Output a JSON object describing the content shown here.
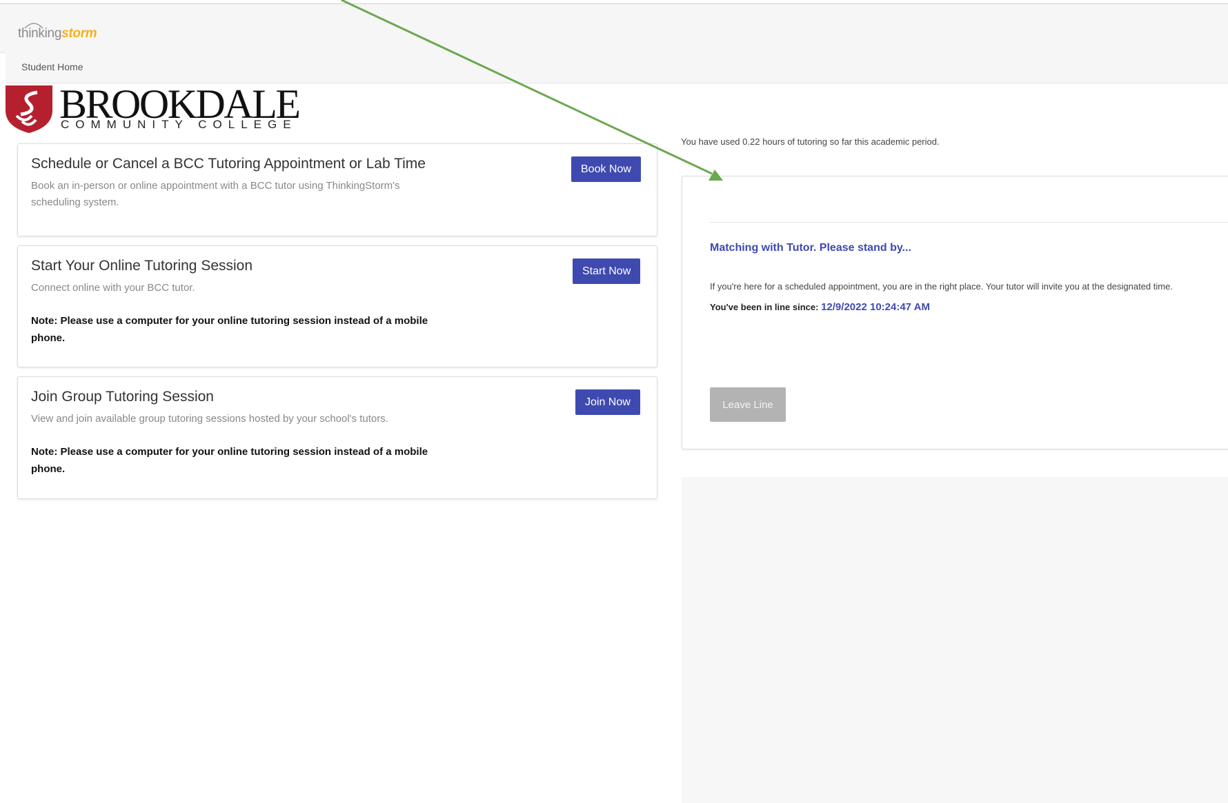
{
  "header": {
    "logo_part1": "thinking",
    "logo_part2": "storm"
  },
  "nav": {
    "student_home": "Student Home"
  },
  "brand": {
    "name": "BROOKDALE",
    "subtitle": "COMMUNITY COLLEGE",
    "shield_color": "#b5202e"
  },
  "cards": [
    {
      "title": "Schedule or Cancel a BCC Tutoring Appointment or Lab Time",
      "description": "Book an in-person or online appointment with a BCC tutor using ThinkingStorm's scheduling system.",
      "button": "Book Now"
    },
    {
      "title": "Start Your Online Tutoring Session",
      "description": "Connect online with your BCC tutor.",
      "note": "Note: Please use a computer for your online tutoring session instead of a mobile phone.",
      "button": "Start Now"
    },
    {
      "title": "Join Group Tutoring Session",
      "description": "View and join available group tutoring sessions hosted by your school's tutors.",
      "note": "Note: Please use a computer for your online tutoring session instead of a mobile phone.",
      "button": "Join Now"
    }
  ],
  "usage": {
    "text": "You have used 0.22 hours of tutoring so far this academic period."
  },
  "queue": {
    "status": "Matching with Tutor. Please stand by...",
    "info": "If you're here for a scheduled appointment, you are in the right place. Your tutor will invite you at the designated time.",
    "since_label": "You've been in line since:",
    "since_value": "12/9/2022 10:24:47 AM",
    "leave_button": "Leave Line"
  },
  "colors": {
    "primary_button": "#3f4ab0",
    "accent_text": "#3f4ab0",
    "annotation_arrow": "#6aa84f",
    "logo_orange": "#f3b21a"
  },
  "icons": {
    "annotation": "arrow-annotation-icon",
    "shield": "brookdale-shield-icon"
  }
}
